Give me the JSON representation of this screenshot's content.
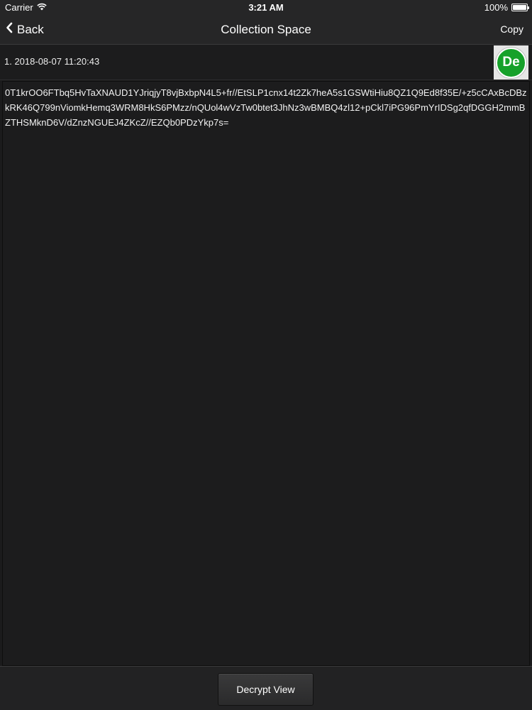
{
  "status_bar": {
    "carrier": "Carrier",
    "time": "3:21 AM",
    "battery": "100%"
  },
  "nav": {
    "back_label": "Back",
    "title": "Collection Space",
    "copy_label": "Copy"
  },
  "entry": {
    "label": "1. 2018-08-07 11:20:43",
    "avatar_initials": "De",
    "avatar_color": "#16a12a",
    "text": "0T1krOO6FTbq5HvTaXNAUD1YJriqjyT8vjBxbpN4L5+fr//EtSLP1cnx14t2Zk7heA5s1GSWtiHiu8QZ1Q9Ed8f35E/+z5cCAxBcDBzkRK46Q799nViomkHemq3WRM8HkS6PMzz/nQUol4wVzTw0btet3JhNz3wBMBQ4zl12+pCkl7iPG96PmYrIDSg2qfDGGH2mmBZTHSMknD6V/dZnzNGUEJ4ZKcZ//EZQb0PDzYkp7s="
  },
  "toolbar": {
    "decrypt_label": "Decrypt View"
  },
  "colors": {
    "background": "#1b1b1c",
    "bar": "#262627",
    "accent_green": "#16a12a"
  },
  "icons": {
    "wifi": "wifi-icon",
    "battery": "battery-icon",
    "back": "chevron-left-icon"
  }
}
